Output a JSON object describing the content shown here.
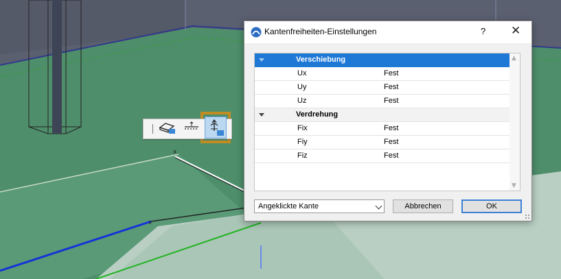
{
  "dialog": {
    "title": "Kantenfreiheiten-Einstellungen",
    "help_label": "?",
    "close_label": "✕",
    "groups": [
      {
        "label": "Verschiebung",
        "rows": [
          {
            "name": "Ux",
            "value": "Fest"
          },
          {
            "name": "Uy",
            "value": "Fest"
          },
          {
            "name": "Uz",
            "value": "Fest"
          }
        ]
      },
      {
        "label": "Verdrehung",
        "rows": [
          {
            "name": "Fix",
            "value": "Fest"
          },
          {
            "name": "Fiy",
            "value": "Fest"
          },
          {
            "name": "Fiz",
            "value": "Fest"
          }
        ]
      }
    ],
    "scope_select": {
      "value": "Angeklickte Kante"
    },
    "cancel_label": "Abbrechen",
    "ok_label": "OK"
  },
  "viewport": {
    "toolbar_icons": [
      "slab-edit-icon",
      "edge-align-icon",
      "edge-support-icon"
    ],
    "colors": {
      "floor": "#4f8f6c",
      "wall": "#5c6070",
      "highlight": "#c18d22",
      "selection": "#1e78d6"
    }
  }
}
